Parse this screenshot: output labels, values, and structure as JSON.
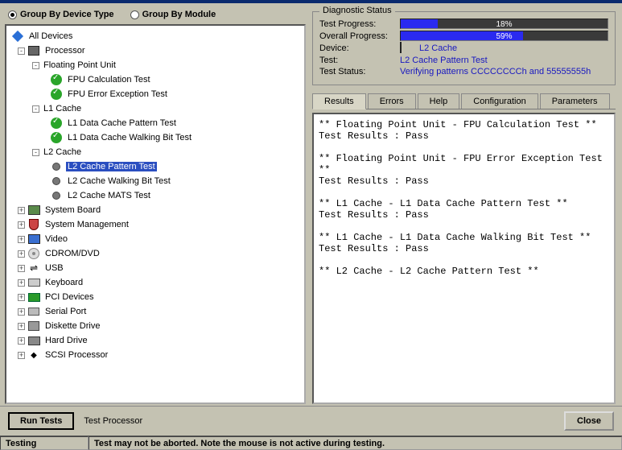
{
  "group_options": {
    "by_device": "Group By Device Type",
    "by_module": "Group By Module",
    "selected": "by_device"
  },
  "tree": {
    "root": "All Devices",
    "processor": {
      "label": "Processor",
      "fpu": {
        "label": "Floating Point Unit",
        "tests": [
          "FPU Calculation Test",
          "FPU Error Exception Test"
        ]
      },
      "l1": {
        "label": "L1 Cache",
        "tests": [
          "L1 Data Cache Pattern Test",
          "L1 Data Cache Walking Bit Test"
        ]
      },
      "l2": {
        "label": "L2 Cache",
        "tests": [
          "L2 Cache Pattern Test",
          "L2 Cache Walking Bit Test",
          "L2 Cache MATS Test"
        ]
      }
    },
    "devices": [
      "System Board",
      "System Management",
      "Video",
      "CDROM/DVD",
      "USB",
      "Keyboard",
      "PCI Devices",
      "Serial Port",
      "Diskette Drive",
      "Hard Drive",
      "SCSI Processor"
    ]
  },
  "diagnostic": {
    "legend": "Diagnostic Status",
    "test_progress_label": "Test Progress:",
    "test_progress_pct": 18,
    "test_progress_text": "18%",
    "overall_progress_label": "Overall Progress:",
    "overall_progress_pct": 59,
    "overall_progress_text": "59%",
    "device_label": "Device:",
    "device_value": "L2 Cache",
    "test_label": "Test:",
    "test_value": "L2 Cache Pattern Test",
    "status_label": "Test Status:",
    "status_value": "Verifying patterns CCCCCCCCh and 55555555h"
  },
  "tabs": [
    "Results",
    "Errors",
    "Help",
    "Configuration",
    "Parameters"
  ],
  "results_text": "** Floating Point Unit - FPU Calculation Test **\nTest Results : Pass\n\n** Floating Point Unit - FPU Error Exception Test **\nTest Results : Pass\n\n** L1 Cache - L1 Data Cache Pattern Test **\nTest Results : Pass\n\n** L1 Cache - L1 Data Cache Walking Bit Test **\nTest Results : Pass\n\n** L2 Cache - L2 Cache Pattern Test **",
  "buttons": {
    "run": "Run Tests",
    "processor": "Test Processor",
    "close": "Close"
  },
  "status_bar": {
    "left": "Testing",
    "right": "Test may not be aborted.  Note the mouse is not active during testing."
  }
}
